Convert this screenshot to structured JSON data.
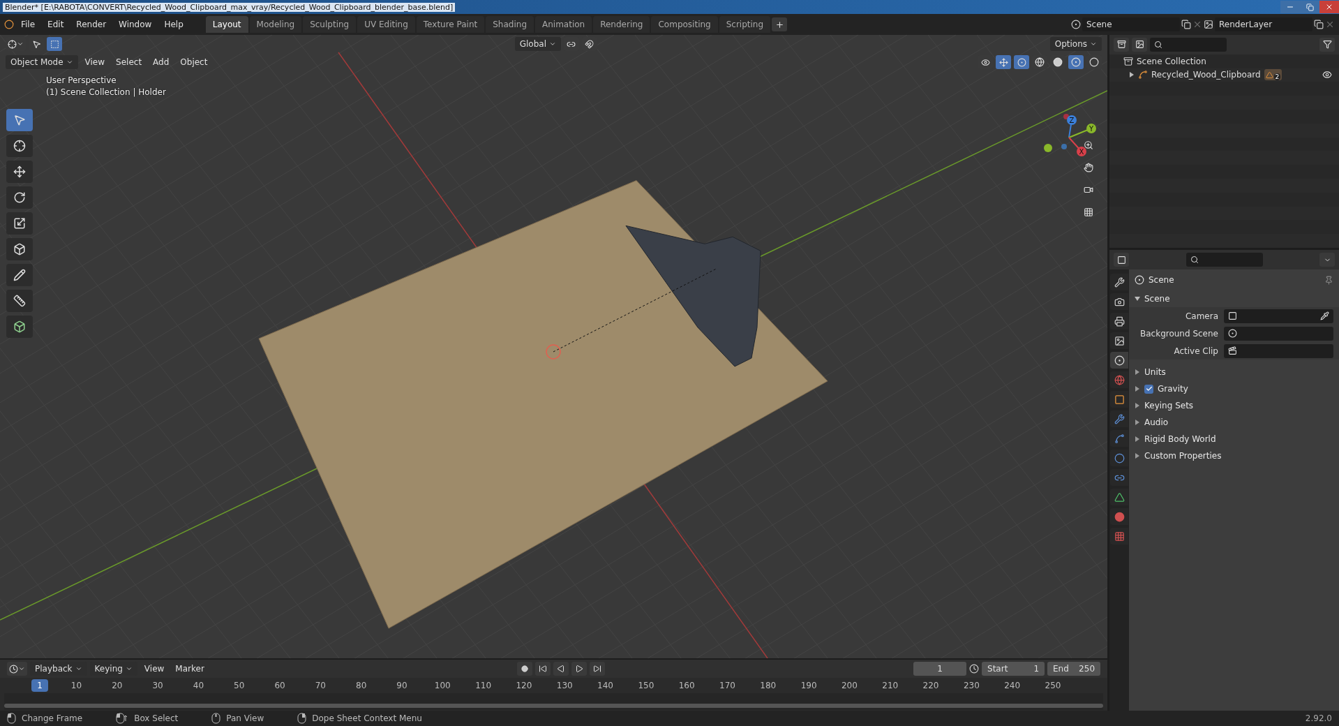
{
  "window": {
    "title": "Blender* [E:\\RABOTA\\CONVERT\\Recycled_Wood_Clipboard_max_vray/Recycled_Wood_Clipboard_blender_base.blend]"
  },
  "menu": [
    "File",
    "Edit",
    "Render",
    "Window",
    "Help"
  ],
  "workspaces": [
    {
      "label": "Layout",
      "selected": true
    },
    {
      "label": "Modeling",
      "selected": false
    },
    {
      "label": "Sculpting",
      "selected": false
    },
    {
      "label": "UV Editing",
      "selected": false
    },
    {
      "label": "Texture Paint",
      "selected": false
    },
    {
      "label": "Shading",
      "selected": false
    },
    {
      "label": "Animation",
      "selected": false
    },
    {
      "label": "Rendering",
      "selected": false
    },
    {
      "label": "Compositing",
      "selected": false
    },
    {
      "label": "Scripting",
      "selected": false
    }
  ],
  "scene_field": "Scene",
  "render_layer_field": "RenderLayer",
  "viewport": {
    "transform": "Global",
    "options": "Options",
    "mode": "Object Mode",
    "menus": [
      "View",
      "Select",
      "Add",
      "Object"
    ],
    "overlay_lines": [
      "User Perspective",
      "(1) Scene Collection | Holder"
    ],
    "tools": [
      {
        "kind": "select",
        "selected": true
      },
      {
        "kind": "cursor",
        "selected": false
      },
      {
        "kind": "move",
        "selected": false
      },
      {
        "kind": "rotate",
        "selected": false
      },
      {
        "kind": "scale",
        "selected": false
      },
      {
        "kind": "transform",
        "selected": false
      },
      {
        "kind": "annotate",
        "selected": false
      },
      {
        "kind": "measure",
        "selected": false
      },
      {
        "kind": "add_cube",
        "selected": false
      }
    ],
    "shading": [
      {
        "kind": "wireframe",
        "selected": false
      },
      {
        "kind": "solid",
        "selected": false
      },
      {
        "kind": "material",
        "selected": true
      },
      {
        "kind": "rendered",
        "selected": false
      }
    ],
    "gizmo_axes": [
      "Z",
      "Y",
      "X"
    ]
  },
  "outliner": {
    "root": "Scene Collection",
    "children": [
      {
        "name": "Recycled_Wood_Clipboard",
        "expanded": false,
        "badge": "2"
      }
    ]
  },
  "properties": {
    "context": "Scene",
    "tabs": [
      {
        "kind": "tool",
        "selected": false
      },
      {
        "kind": "render",
        "selected": false
      },
      {
        "kind": "output",
        "selected": false
      },
      {
        "kind": "view_layer",
        "selected": false
      },
      {
        "kind": "scene",
        "selected": true
      },
      {
        "kind": "world",
        "selected": false
      },
      {
        "kind": "object",
        "selected": false
      },
      {
        "kind": "modifier",
        "selected": false
      },
      {
        "kind": "particles",
        "selected": false
      },
      {
        "kind": "physics",
        "selected": false
      },
      {
        "kind": "constraints",
        "selected": false
      },
      {
        "kind": "data",
        "selected": false
      },
      {
        "kind": "material",
        "selected": false
      },
      {
        "kind": "texture",
        "selected": false
      }
    ],
    "panel": {
      "title": "Scene",
      "expanded": true,
      "fields": [
        {
          "label": "Camera",
          "kind": "camera"
        },
        {
          "label": "Background Scene",
          "kind": "scene"
        },
        {
          "label": "Active Clip",
          "kind": "clip"
        }
      ]
    },
    "subpanels": [
      {
        "title": "Units",
        "kind": "plain"
      },
      {
        "title": "Gravity",
        "kind": "checkbox",
        "checked": true
      },
      {
        "title": "Keying Sets",
        "kind": "plain"
      },
      {
        "title": "Audio",
        "kind": "plain"
      },
      {
        "title": "Rigid Body World",
        "kind": "plain"
      },
      {
        "title": "Custom Properties",
        "kind": "plain"
      }
    ]
  },
  "timeline": {
    "menus": [
      "Playback",
      "Keying",
      "View",
      "Marker"
    ],
    "current_frame": "1",
    "start_label": "Start",
    "start": "1",
    "end_label": "End",
    "end": "250",
    "marker": "1",
    "ticks": [
      "10",
      "20",
      "30",
      "40",
      "50",
      "60",
      "70",
      "80",
      "90",
      "100",
      "110",
      "120",
      "130",
      "140",
      "150",
      "160",
      "170",
      "180",
      "190",
      "200",
      "210",
      "220",
      "230",
      "240",
      "250"
    ]
  },
  "status_bar": {
    "hints": [
      {
        "kind": "left",
        "label": "Change Frame"
      },
      {
        "kind": "drag",
        "label": "Box Select"
      },
      {
        "kind": "middle",
        "label": "Pan View"
      },
      {
        "kind": "right",
        "label": "Dope Sheet Context Menu"
      }
    ],
    "version": "2.92.0"
  }
}
